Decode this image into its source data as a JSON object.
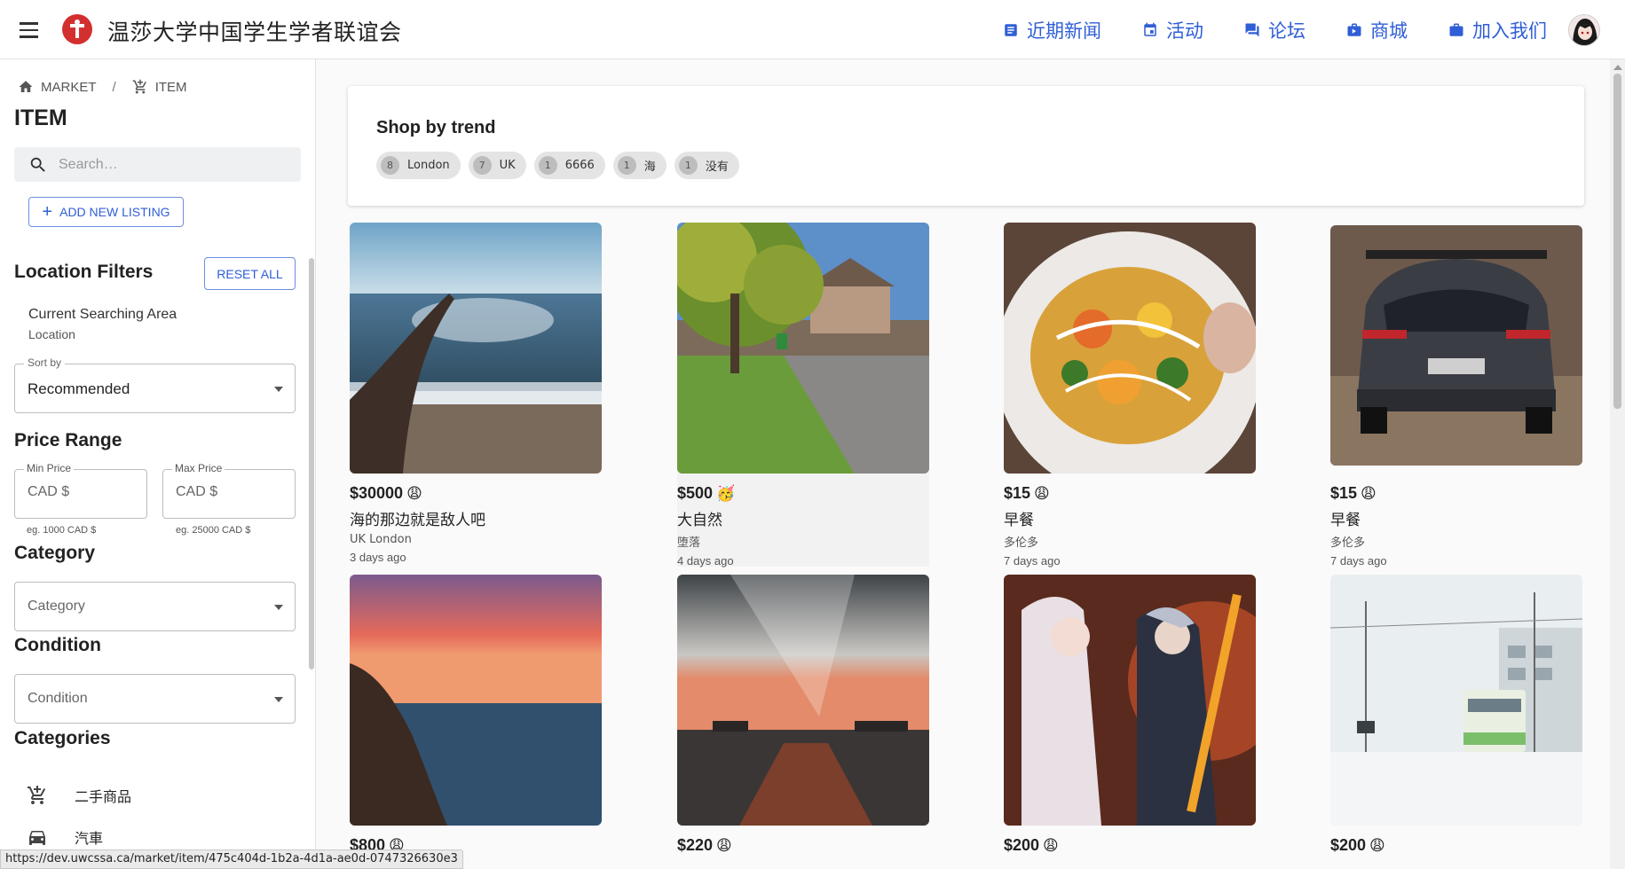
{
  "header": {
    "site_title": "温莎大学中国学生学者联谊会",
    "nav": [
      {
        "label": "近期新闻",
        "icon": "article-icon"
      },
      {
        "label": "活动",
        "icon": "calendar-icon"
      },
      {
        "label": "论坛",
        "icon": "forum-icon"
      },
      {
        "label": "商城",
        "icon": "store-icon"
      },
      {
        "label": "加入我们",
        "icon": "briefcase-icon"
      }
    ],
    "brand_color": "#d32f2f",
    "accent_color": "#2f5ed6"
  },
  "sidebar": {
    "breadcrumb": {
      "home": "MARKET",
      "current": "ITEM"
    },
    "page_title": "ITEM",
    "search_placeholder": "Search…",
    "add_button": "ADD NEW LISTING",
    "location_filters_title": "Location Filters",
    "reset_button": "RESET ALL",
    "area_title": "Current Searching Area",
    "area_sub": "Location",
    "sort_legend": "Sort by",
    "sort_value": "Recommended",
    "price_title": "Price Range",
    "min_legend": "Min Price",
    "min_placeholder": "CAD $",
    "min_helper": "eg. 1000 CAD $",
    "max_legend": "Max Price",
    "max_placeholder": "CAD $",
    "max_helper": "eg. 25000 CAD $",
    "category_title": "Category",
    "category_placeholder": "Category",
    "condition_title": "Condition",
    "condition_placeholder": "Condition",
    "categories_title": "Categories",
    "categories": [
      {
        "label": "二手商品",
        "icon": "cart-icon"
      },
      {
        "label": "汽車",
        "icon": "car-icon"
      }
    ]
  },
  "trend": {
    "title": "Shop by trend",
    "chips": [
      {
        "count": "8",
        "label": "London"
      },
      {
        "count": "7",
        "label": "UK"
      },
      {
        "count": "1",
        "label": "6666"
      },
      {
        "count": "1",
        "label": "海"
      },
      {
        "count": "1",
        "label": "没有"
      }
    ]
  },
  "listings": [
    {
      "price": "$30000",
      "emoji": "😩",
      "title": "海的那边就是敌人吧",
      "location": "UK London",
      "time": "3 days ago"
    },
    {
      "price": "$500",
      "emoji": "🥳",
      "title": "大自然",
      "location": "堕落",
      "time": "4 days ago"
    },
    {
      "price": "$15",
      "emoji": "😩",
      "title": "早餐",
      "location": "多伦多",
      "time": "7 days ago"
    },
    {
      "price": "$15",
      "emoji": "😩",
      "title": "早餐",
      "location": "多伦多",
      "time": "7 days ago"
    },
    {
      "price": "$800",
      "emoji": "😩",
      "title": "",
      "location": "",
      "time": ""
    },
    {
      "price": "$220",
      "emoji": "😩",
      "title": "",
      "location": "",
      "time": ""
    },
    {
      "price": "$200",
      "emoji": "😩",
      "title": "",
      "location": "",
      "time": ""
    },
    {
      "price": "$200",
      "emoji": "😩",
      "title": "",
      "location": "",
      "time": ""
    }
  ],
  "status_url": "https://dev.uwcssa.ca/market/item/475c404d-1b2a-4d1a-ae0d-0747326630e3"
}
